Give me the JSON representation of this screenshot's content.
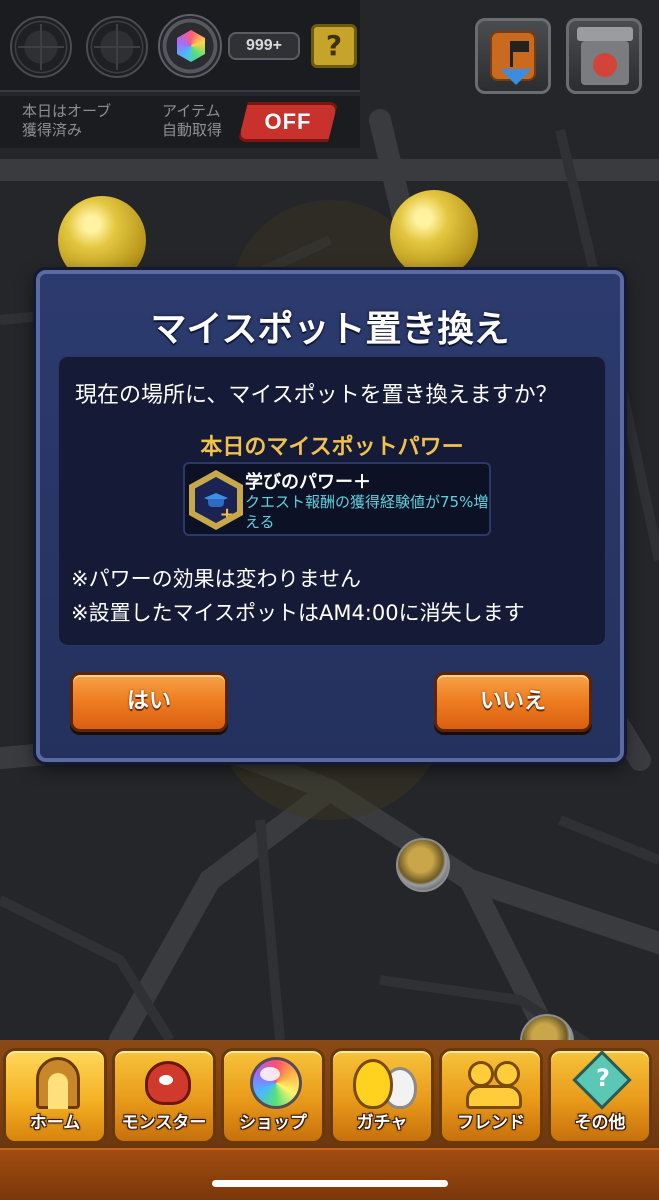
{
  "hud": {
    "gem_count": "999+",
    "help_label": "?",
    "orb_status_line1": "本日はオーブ",
    "orb_status_line2": "獲得済み",
    "auto_collect_line1": "アイテム",
    "auto_collect_line2": "自動取得",
    "auto_collect_value": "OFF"
  },
  "dialog": {
    "title": "マイスポット置き換え",
    "question": "現在の場所に、マイスポットを置き換えますか？",
    "power_heading": "本日のマイスポットパワー",
    "power_name": "学びのパワー＋",
    "power_description": "クエスト報酬の獲得経験値が75%増える",
    "note1": "※パワーの効果は変わりません",
    "note2": "※設置したマイスポットはAM4:00に消失します",
    "yes_label": "はい",
    "no_label": "いいえ"
  },
  "nav": {
    "items": [
      {
        "label": "ホーム",
        "icon": "home-gate-icon",
        "active": true
      },
      {
        "label": "モンスター",
        "icon": "monster-icon",
        "active": false
      },
      {
        "label": "ショップ",
        "icon": "orb-icon",
        "active": false
      },
      {
        "label": "ガチャ",
        "icon": "egg-icon",
        "active": false
      },
      {
        "label": "フレンド",
        "icon": "friends-icon",
        "active": false
      },
      {
        "label": "その他",
        "icon": "other-icon",
        "active": false
      }
    ]
  },
  "colors": {
    "dialog_bg": "#2c3b6e",
    "power_heading": "#f2c14a",
    "power_description": "#5fd0dc",
    "button_orange": "#ef7f22",
    "off_red": "#c8312c",
    "nav_gold": "#f7c33a"
  }
}
